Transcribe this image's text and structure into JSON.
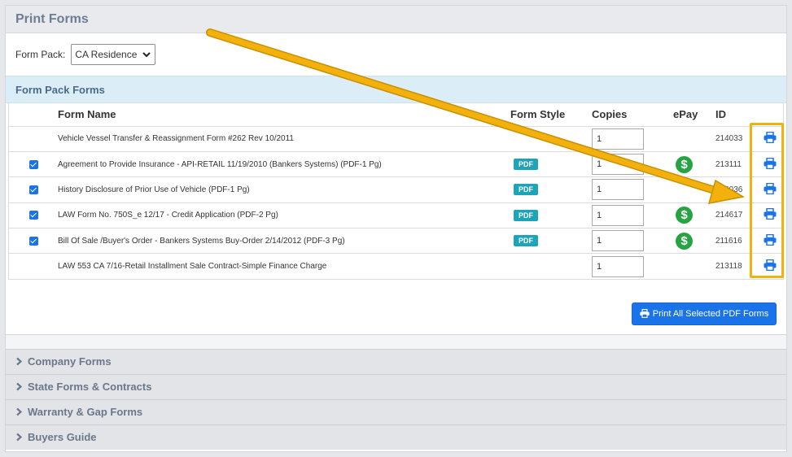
{
  "page": {
    "title": "Print Forms"
  },
  "form_pack": {
    "label": "Form Pack:",
    "selected": "CA Residence"
  },
  "form_pack_forms": {
    "title": "Form Pack Forms",
    "columns": {
      "name": "Form Name",
      "style": "Form Style",
      "copies": "Copies",
      "epay": "ePay",
      "id": "ID"
    },
    "rows": [
      {
        "checked": false,
        "name": "Vehicle Vessel Transfer & Reassignment Form #262 Rev 10/2011",
        "style": "",
        "copies": "1",
        "epay": false,
        "id": "214033"
      },
      {
        "checked": true,
        "name": "Agreement to Provide Insurance - API-RETAIL 11/19/2010 (Bankers Systems) (PDF-1 Pg)",
        "style": "PDF",
        "copies": "1",
        "epay": true,
        "id": "213111"
      },
      {
        "checked": true,
        "name": "History Disclosure of Prior Use of Vehicle (PDF-1 Pg)",
        "style": "PDF",
        "copies": "1",
        "epay": false,
        "id": "214036"
      },
      {
        "checked": true,
        "name": "LAW Form No. 750S_e 12/17 - Credit Application (PDF-2 Pg)",
        "style": "PDF",
        "copies": "1",
        "epay": true,
        "id": "214617"
      },
      {
        "checked": true,
        "name": "Bill Of Sale /Buyer's Order - Bankers Systems Buy-Order 2/14/2012 (PDF-3 Pg)",
        "style": "PDF",
        "copies": "1",
        "epay": true,
        "id": "211616"
      },
      {
        "checked": false,
        "name": "LAW 553 CA 7/16-Retail Installment Sale Contract-Simple Finance Charge",
        "style": "",
        "copies": "1",
        "epay": false,
        "id": "213118"
      }
    ],
    "epay_symbol": "$",
    "print_all_label": "Print All Selected PDF Forms"
  },
  "accordion": [
    {
      "label": "Company Forms"
    },
    {
      "label": "State Forms & Contracts"
    },
    {
      "label": "Warranty & Gap Forms"
    },
    {
      "label": "Buyers Guide"
    }
  ],
  "icons": {
    "print": "printer-icon",
    "caret": "chevron-right-icon",
    "select": "chevron-down-icon",
    "epay": "dollar-circle-icon"
  },
  "colors": {
    "accent_blue": "#1a73e8",
    "pdf_badge": "#1ea3b9",
    "epay_green": "#27a344",
    "annotation_yellow": "#f2b10c",
    "section_header_bg": "#dbeef7"
  }
}
